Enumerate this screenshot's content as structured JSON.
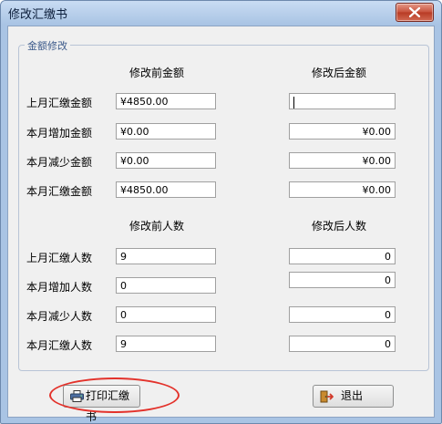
{
  "window": {
    "title": "修改汇缴书"
  },
  "group": {
    "label": "金额修改"
  },
  "amount_section": {
    "before_header": "修改前金额",
    "after_header": "修改后金额",
    "rows": [
      {
        "label": "上月汇缴金额",
        "before": "¥4850.00",
        "after": ""
      },
      {
        "label": "本月增加金额",
        "before": "¥0.00",
        "after": "¥0.00"
      },
      {
        "label": "本月减少金额",
        "before": "¥0.00",
        "after": "¥0.00"
      },
      {
        "label": "本月汇缴金额",
        "before": "¥4850.00",
        "after": "¥0.00"
      }
    ]
  },
  "count_section": {
    "before_header": "修改前人数",
    "after_header": "修改后人数",
    "rows": [
      {
        "label": "上月汇缴人数",
        "before": "9",
        "after": "0"
      },
      {
        "label": "本月增加人数",
        "before": "0",
        "after": "0"
      },
      {
        "label": "本月减少人数",
        "before": "0",
        "after": "0"
      },
      {
        "label": "本月汇缴人数",
        "before": "9",
        "after": "0"
      }
    ]
  },
  "buttons": {
    "print_label": "打印汇缴书",
    "exit_label": "退出"
  },
  "icons": {
    "close": "close-icon",
    "print": "printer-icon",
    "exit": "exit-door-icon"
  },
  "colors": {
    "title_bar": "#a9c4e4",
    "close_button": "#c7503b",
    "highlight_ring": "#e3322b"
  }
}
